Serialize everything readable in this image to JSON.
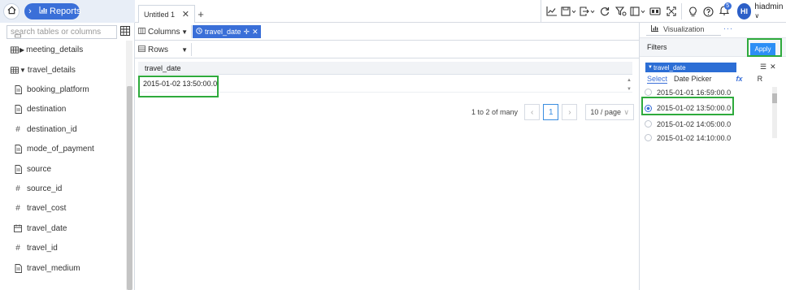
{
  "breadcrumb": {
    "current": "Reports"
  },
  "tabs": [
    {
      "label": "Untitled 1"
    }
  ],
  "tab_add": "+",
  "user": {
    "initials": "HI",
    "name": "hiadmin"
  },
  "notifications": {
    "count": "5"
  },
  "sidebar": {
    "search_placeholder": "search tables or columns",
    "fields": [
      {
        "label": "",
        "icon": "text-icon"
      },
      {
        "label": "meeting_details",
        "icon": "table-collapsed-icon"
      },
      {
        "label": "travel_details",
        "icon": "table-expanded-icon"
      },
      {
        "label": "booking_platform",
        "icon": "text-icon"
      },
      {
        "label": "destination",
        "icon": "text-icon"
      },
      {
        "label": "destination_id",
        "icon": "number-icon"
      },
      {
        "label": "mode_of_payment",
        "icon": "text-icon"
      },
      {
        "label": "source",
        "icon": "text-icon"
      },
      {
        "label": "source_id",
        "icon": "number-icon"
      },
      {
        "label": "travel_cost",
        "icon": "number-icon"
      },
      {
        "label": "travel_date",
        "icon": "calendar-icon"
      },
      {
        "label": "travel_id",
        "icon": "number-icon"
      },
      {
        "label": "travel_medium",
        "icon": "text-icon"
      }
    ]
  },
  "canvas": {
    "columns_label": "Columns",
    "column_chip": "travel_date",
    "rows_label": "Rows",
    "table": {
      "header": "travel_date",
      "rows": [
        "2015-01-02 13:50:00.0"
      ]
    },
    "pagination": {
      "summary": "1 to 2 of many",
      "current_page": "1",
      "page_size": "10 / page"
    }
  },
  "right_panel": {
    "viz_tab": "Visualization",
    "viz_more": "···",
    "filters_title": "Filters",
    "apply_label": "Apply",
    "filter_field": "travel_date",
    "subtabs": {
      "select": "Select",
      "date_picker": "Date Picker",
      "fx": "fx",
      "r": "R"
    },
    "options": [
      {
        "label": "2015-01-01 16:59:00.0",
        "selected": false
      },
      {
        "label": "2015-01-02 13:50:00.0",
        "selected": true
      },
      {
        "label": "2015-01-02 14:05:00.0",
        "selected": false
      },
      {
        "label": "2015-01-02 14:10:00.0",
        "selected": false
      }
    ]
  },
  "colors": {
    "accent": "#3a6fd8",
    "highlight": "#2eaa3c",
    "apply": "#2c8ef5"
  }
}
